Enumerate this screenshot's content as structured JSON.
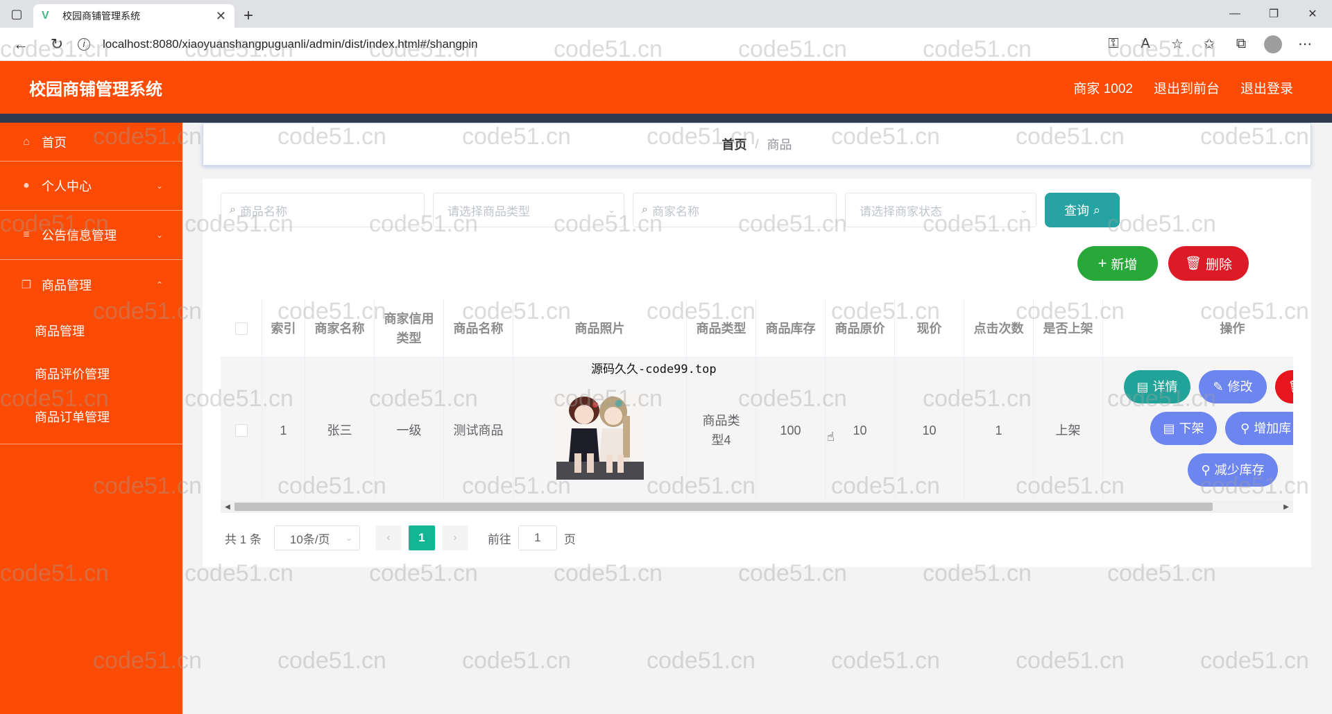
{
  "browser": {
    "tab_title": "校园商铺管理系统",
    "url": "localhost:8080/xiaoyuanshangpuguanli/admin/dist/index.html#/shangpin"
  },
  "header": {
    "title": "校园商铺管理系统",
    "user": "商家 1002",
    "exit_front": "退出到前台",
    "logout": "退出登录"
  },
  "sidebar": {
    "items": [
      {
        "label": "首页",
        "icon": "home-icon"
      },
      {
        "label": "个人中心",
        "icon": "user-icon"
      },
      {
        "label": "公告信息管理",
        "icon": "list-icon"
      },
      {
        "label": "商品管理",
        "icon": "copy-icon"
      }
    ],
    "sub_items": [
      "商品管理",
      "商品评价管理",
      "商品订单管理"
    ]
  },
  "breadcrumb": {
    "home": "首页",
    "separator": "/",
    "current": "商品"
  },
  "search": {
    "product_name_placeholder": "商品名称",
    "product_type_placeholder": "请选择商品类型",
    "merchant_name_placeholder": "商家名称",
    "merchant_status_placeholder": "请选择商家状态",
    "query_label": "查询"
  },
  "actions": {
    "add_label": "新增",
    "delete_label": "删除"
  },
  "table": {
    "headers": {
      "index": "索引",
      "merchant_name": "商家名称",
      "credit_type": "商家信用类型",
      "product_name": "商品名称",
      "photo": "商品照片",
      "product_type": "商品类型",
      "stock": "商品库存",
      "original_price": "商品原价",
      "current_price": "现价",
      "clicks": "点击次数",
      "on_shelf": "是否上架",
      "ops": "操作"
    },
    "row": {
      "index": "1",
      "merchant_name": "张三",
      "credit_type": "一级",
      "product_name": "测试商品",
      "photo_caption": "源码久久-code99.top",
      "product_type": "商品类型4",
      "stock": "100",
      "original_price": "10",
      "current_price": "10",
      "clicks": "1",
      "on_shelf": "上架"
    },
    "ops": {
      "detail": "详情",
      "edit": "修改",
      "off_shelf": "下架",
      "add_stock": "增加库",
      "reduce_stock": "减少库存"
    }
  },
  "pagination": {
    "total": "共 1 条",
    "page_size": "10条/页",
    "current": "1",
    "goto_prefix": "前往",
    "goto_value": "1",
    "goto_suffix": "页"
  },
  "watermark_text": "code51.cn",
  "colors": {
    "header": "#fb4b04",
    "sidebar": "#fb4b04",
    "query": "#28a3a3",
    "add": "#27a838",
    "delete": "#dd1b26",
    "page_active": "#14b594"
  }
}
